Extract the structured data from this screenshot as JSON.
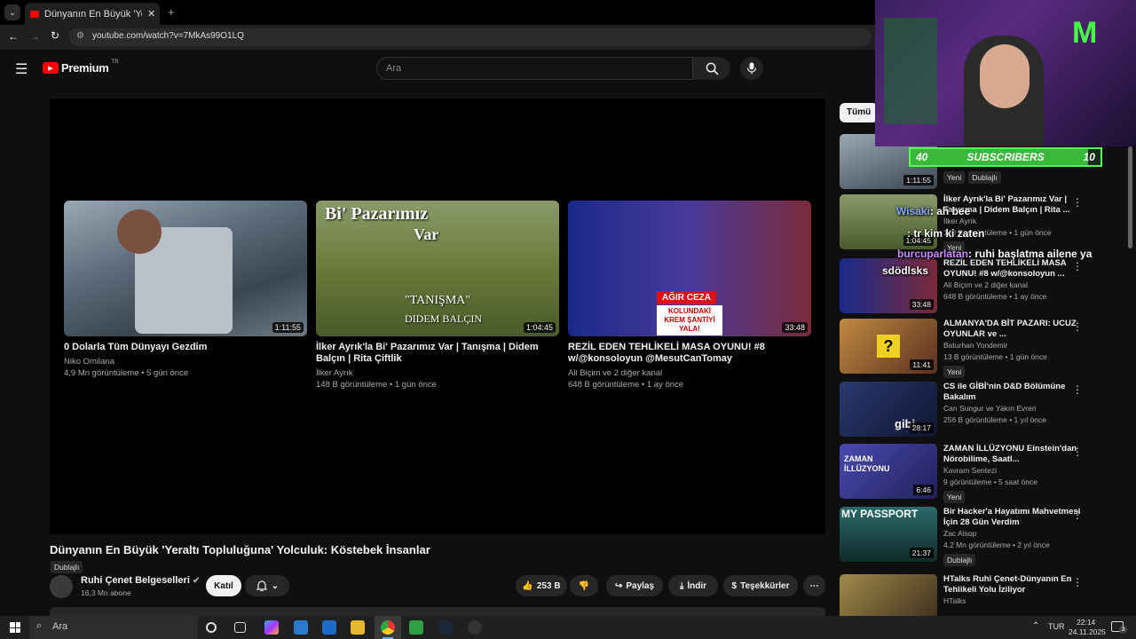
{
  "browser": {
    "tab_title": "Dünyanın En Büyük 'Yeraltı Topl",
    "url": "youtube.com/watch?v=7MkAs99O1LQ"
  },
  "youtube": {
    "logo": "Premium",
    "logo_sup": "TR",
    "search_placeholder": "Ara"
  },
  "endscreen": [
    {
      "title": "0 Dolarla Tüm Dünyayı Gezdim",
      "channel": "Niko Omilana",
      "stats": "4,9 Mn görüntüleme • 5 gün önce",
      "duration": "1:11:55",
      "color": "#6a7a88"
    },
    {
      "title": "İlker Ayrık'la Bi' Pazarımız Var | Tanışma | Didem Balçın | Rita Çiftlik",
      "channel": "İlker Ayrık",
      "stats": "148 B görüntüleme • 1 gün önce",
      "duration": "1:04:45",
      "color": "#6b7a3a"
    },
    {
      "title": "REZİL EDEN TEHLİKELİ MASA OYUNU! #8 w/@konsoloyun @MesutCanTomay",
      "channel": "Ali Biçim ve 2 diğer kanal",
      "stats": "648 B görüntüleme • 1 ay önce",
      "duration": "33:48",
      "color": "#3b3f8a"
    }
  ],
  "thumb_text": {
    "t2_line1": "Bi' Pazarımız",
    "t2_line2": "Var",
    "t2_tanisma": "\"TANIŞMA\"",
    "t2_didem": "DIDEM BALÇIN",
    "t3_ceza": "AĞIR CEZA",
    "t3_krem": "KOLUNDAKİ KREM ŞANTİYİ YALA!"
  },
  "video": {
    "title": "Dünyanın En Büyük 'Yeraltı Topluluğuna' Yolculuk: Köstebek İnsanlar",
    "badge": "Dublajlı",
    "channel": "Ruhi Çenet Belgeselleri",
    "subs": "16,3 Mn abone",
    "join": "Katıl",
    "likes": "253 B",
    "share": "Paylaş",
    "download": "İndir",
    "thanks": "Teşekkürler"
  },
  "sidebar": {
    "chip_all": "Tümü",
    "items": [
      {
        "title": "",
        "channel": "",
        "stats": "",
        "badge": "Yeni",
        "badge2": "Dublajlı",
        "duration": "1:11:55",
        "color": "#5a6470"
      },
      {
        "title": "İlker Ayrık'la Bi' Pazarımız Var | Tanışma | Didem Balçın | Rita ...",
        "channel": "İlker Ayrık",
        "stats": "148 B görüntüleme • 1 gün önce",
        "badge": "Yeni",
        "duration": "1:04:45",
        "color": "#6b7a3a"
      },
      {
        "title": "REZİL EDEN TEHLİKELİ MASA OYUNU! #8 w/@konsoloyun ...",
        "channel": "Ali Biçim ve 2 diğer kanal",
        "stats": "648 B görüntüleme • 1 ay önce",
        "badge": "",
        "duration": "33:48",
        "color": "#3b3f8a"
      },
      {
        "title": "ALMANYA'DA BİT PAZARI: UCUZ OYUNLAR ve ...",
        "channel": "Baturhan Yondemir",
        "stats": "13 B görüntüleme • 1 gün önce",
        "badge": "Yeni",
        "duration": "11:41",
        "color": "#7a4a30"
      },
      {
        "title": "CS ile GİBİ'nin D&D Bölümüne Bakalım",
        "channel": "Can Sungur ve Yakın Evren",
        "stats": "256 B görüntüleme • 1 yıl önce",
        "badge": "",
        "duration": "28:17",
        "color": "#1e2a50"
      },
      {
        "title": "ZAMAN İLLÜZYONU Einstein'dan Nörobilime, Saatl...",
        "channel": "Kavram Sentezi",
        "stats": "9 görüntüleme • 5 saat önce",
        "badge": "Yeni",
        "duration": "6:46",
        "color": "#3a3a90"
      },
      {
        "title": "Bir Hacker'a Hayatımı Mahvetmesi İçin 28 Gün Verdim",
        "channel": "Zac Alsop",
        "stats": "4,2 Mn görüntüleme • 2 yıl önce",
        "badge": "Dublajlı",
        "duration": "21:37",
        "color": "#1e4a4a"
      },
      {
        "title": "HTalks Ruhi Çenet-Dünyanın En Tehlikeli Yolu İziliyor",
        "channel": "HTalks",
        "stats": "",
        "badge": "",
        "duration": "",
        "color": "#7a6a3a"
      }
    ],
    "thumb_labels": {
      "zaman": "ZAMAN İLLÜZYONU",
      "passport": "MY PASSPORT",
      "gibi": "gibi"
    }
  },
  "stream": {
    "sub_left": "40",
    "sub_label": "SUBSCRIBERS",
    "sub_right": "10",
    "chat": [
      {
        "user": "Wisaki",
        "msg": ": ah bee"
      },
      {
        "user": "",
        "msg": ": tr kim ki zaten"
      },
      {
        "user": "burcuparlatan",
        "msg": ": ruhi başlatma ailene ya"
      },
      {
        "user": "",
        "msg": "sdödlsks"
      }
    ]
  },
  "taskbar": {
    "search": "Ara",
    "lang": "TUR",
    "time": "22:14",
    "date": "24.11.2025",
    "notif": "3"
  }
}
